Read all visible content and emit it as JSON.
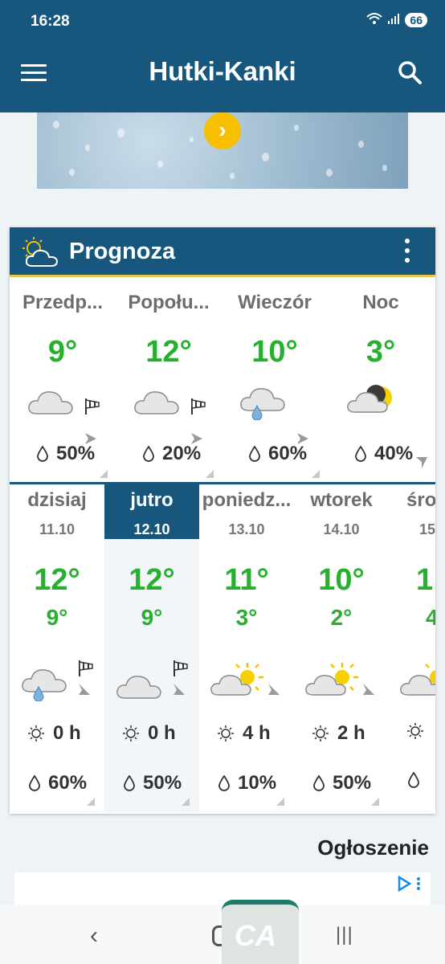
{
  "status_bar": {
    "time": "16:28",
    "battery": "66"
  },
  "app_bar": {
    "title": "Hutki-Kanki"
  },
  "forecast": {
    "title": "Prognoza",
    "parts_of_day": [
      {
        "name": "Przedp...",
        "temp": "9°",
        "precip": "50%",
        "icon": "cloud-icon"
      },
      {
        "name": "Popołu...",
        "temp": "12°",
        "precip": "20%",
        "icon": "cloud-icon"
      },
      {
        "name": "Wieczór",
        "temp": "10°",
        "precip": "60%",
        "icon": "cloud-rain-icon"
      },
      {
        "name": "Noc",
        "temp": "3°",
        "precip": "40%",
        "icon": "cloud-moon-icon"
      }
    ],
    "days": [
      {
        "name": "dzisiaj",
        "date": "11.10",
        "max": "12°",
        "min": "9°",
        "sun": "0 h",
        "precip": "60%",
        "icon": "cloud-rain-icon"
      },
      {
        "name": "jutro",
        "date": "12.10",
        "max": "12°",
        "min": "9°",
        "sun": "0 h",
        "precip": "50%",
        "icon": "cloud-icon"
      },
      {
        "name": "poniedz...",
        "date": "13.10",
        "max": "11°",
        "min": "3°",
        "sun": "4 h",
        "precip": "10%",
        "icon": "cloud-sun-icon"
      },
      {
        "name": "wtorek",
        "date": "14.10",
        "max": "10°",
        "min": "2°",
        "sun": "2 h",
        "precip": "50%",
        "icon": "cloud-sun-icon"
      },
      {
        "name": "śro",
        "date": "15.",
        "max": "1",
        "min": "4",
        "sun": "",
        "precip": "",
        "icon": "cloud-sun-icon"
      }
    ]
  },
  "ad": {
    "label": "Ogłoszenie"
  },
  "colors": {
    "primary": "#17577e",
    "temp_green": "#26b02e",
    "accent_yellow": "#f6c000"
  }
}
